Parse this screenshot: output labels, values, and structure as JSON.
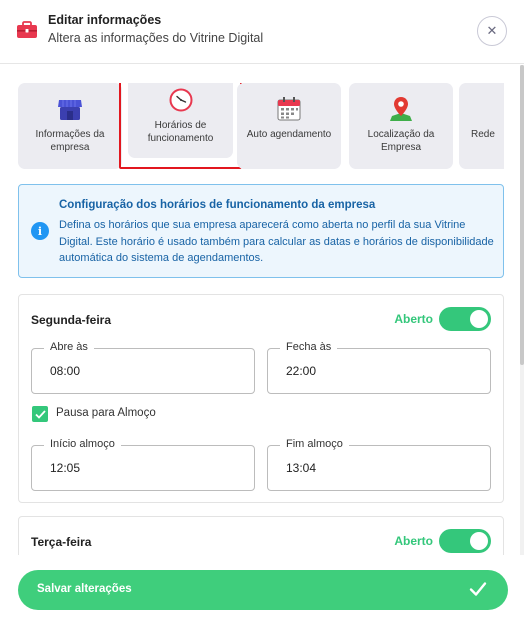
{
  "header": {
    "title": "Editar informações",
    "subtitle": "Altera as informações do Vitrine Digital",
    "close_icon": "✕"
  },
  "tabs": [
    {
      "label": "Informações da empresa",
      "icon": "store-icon"
    },
    {
      "label": "Horários de funcionamento",
      "icon": "clock-icon",
      "active": true
    },
    {
      "label": "Auto agendamento",
      "icon": "calendar-icon"
    },
    {
      "label": "Localização da Empresa",
      "icon": "map-pin-icon"
    },
    {
      "label": "Rede",
      "icon": "social-icon"
    }
  ],
  "info": {
    "icon": "i",
    "title": "Configuração dos horários de funcionamento da empresa",
    "text": "Defina os horários que sua empresa aparecerá como aberta no perfil da sua Vitrine Digital. Este horário é usado também para calcular as datas e horários de disponibilidade automática do sistema de agendamentos."
  },
  "days": [
    {
      "name": "Segunda-feira",
      "status": "Aberto",
      "open_label": "Abre às",
      "open_value": "08:00",
      "close_label": "Fecha às",
      "close_value": "22:00",
      "lunch_label": "Pausa para Almoço",
      "lunch_start_label": "Início almoço",
      "lunch_start_value": "12:05",
      "lunch_end_label": "Fim almoço",
      "lunch_end_value": "13:04"
    },
    {
      "name": "Terça-feira",
      "status": "Aberto"
    }
  ],
  "footer": {
    "save_label": "Salvar alterações"
  },
  "colors": {
    "accent_green": "#3fce7c",
    "info_blue": "#1863a5",
    "highlight_red": "#e2171f"
  }
}
